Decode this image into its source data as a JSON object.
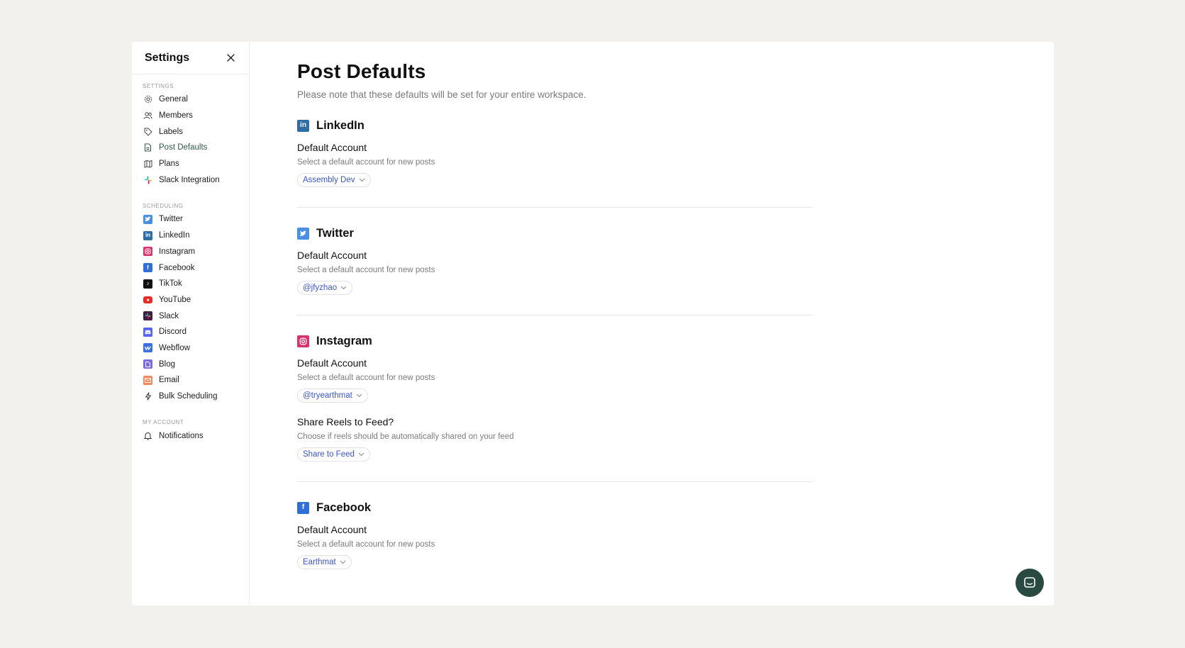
{
  "sidebar": {
    "title": "Settings",
    "sections": {
      "settings_label": "SETTINGS",
      "scheduling_label": "SCHEDULING",
      "account_label": "MY ACCOUNT"
    },
    "settings_items": [
      {
        "label": "General",
        "icon": "gear-icon"
      },
      {
        "label": "Members",
        "icon": "users-icon"
      },
      {
        "label": "Labels",
        "icon": "tag-icon"
      },
      {
        "label": "Post Defaults",
        "icon": "document-icon",
        "active": true
      },
      {
        "label": "Plans",
        "icon": "map-icon"
      },
      {
        "label": "Slack Integration",
        "icon": "slack-icon"
      }
    ],
    "scheduling_items": [
      {
        "label": "Twitter",
        "icon": "twitter-icon",
        "color": "#4a90e2"
      },
      {
        "label": "LinkedIn",
        "icon": "linkedin-icon",
        "color": "#2f6ea5"
      },
      {
        "label": "Instagram",
        "icon": "instagram-icon",
        "color": "#d7336c"
      },
      {
        "label": "Facebook",
        "icon": "facebook-icon",
        "color": "#2f6fd6"
      },
      {
        "label": "TikTok",
        "icon": "tiktok-icon",
        "color": "#111111"
      },
      {
        "label": "YouTube",
        "icon": "youtube-icon",
        "color": "#e52d27"
      },
      {
        "label": "Slack",
        "icon": "slack-icon",
        "color": "#3e1c44"
      },
      {
        "label": "Discord",
        "icon": "discord-icon",
        "color": "#5865f2"
      },
      {
        "label": "Webflow",
        "icon": "webflow-icon",
        "color": "#3b6fe0"
      },
      {
        "label": "Blog",
        "icon": "blog-icon",
        "color": "#7b6be0"
      },
      {
        "label": "Email",
        "icon": "email-icon",
        "color": "#f08a5d"
      },
      {
        "label": "Bulk Scheduling",
        "icon": "lightning-icon"
      }
    ],
    "account_items": [
      {
        "label": "Notifications",
        "icon": "bell-icon"
      }
    ]
  },
  "main": {
    "title": "Post Defaults",
    "subtitle": "Please note that these defaults will be set for your entire workspace.",
    "sections": [
      {
        "name": "LinkedIn",
        "color": "#2f6ea5",
        "fields": [
          {
            "label": "Default Account",
            "desc": "Select a default account for new posts",
            "value": "Assembly Dev"
          }
        ]
      },
      {
        "name": "Twitter",
        "color": "#4a90e2",
        "fields": [
          {
            "label": "Default Account",
            "desc": "Select a default account for new posts",
            "value": "@jfyzhao"
          }
        ]
      },
      {
        "name": "Instagram",
        "color": "#d7336c",
        "fields": [
          {
            "label": "Default Account",
            "desc": "Select a default account for new posts",
            "value": "@tryearthmat"
          },
          {
            "label": "Share Reels to Feed?",
            "desc": "Choose if reels should be automatically shared on your feed",
            "value": "Share to Feed"
          }
        ]
      },
      {
        "name": "Facebook",
        "color": "#2f6fd6",
        "fields": [
          {
            "label": "Default Account",
            "desc": "Select a default account for new posts",
            "value": "Earthmat"
          }
        ]
      }
    ]
  },
  "colors": {
    "accent_active": "#2f5a4a",
    "dropdown_text": "#3b55c9",
    "chat_button": "#2a4a41"
  }
}
